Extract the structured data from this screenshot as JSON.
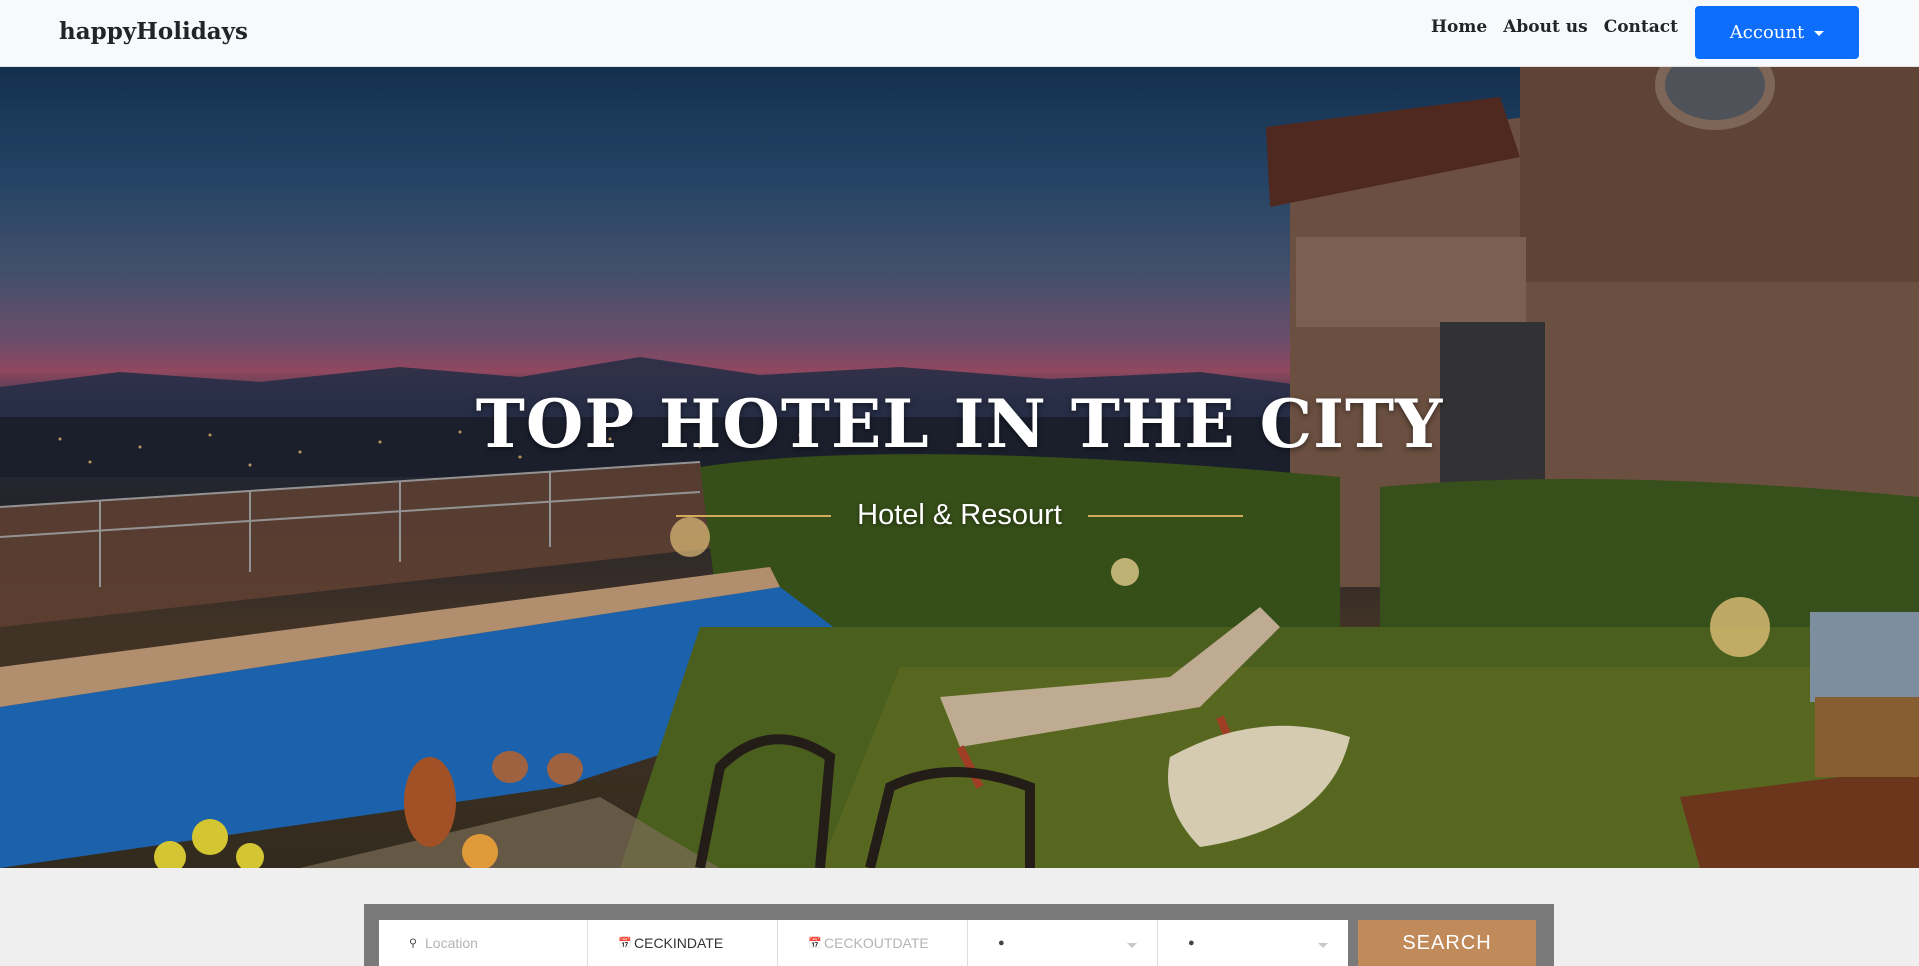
{
  "navbar": {
    "brand": "happyHolidays",
    "links": [
      "Home",
      "About us",
      "Contact"
    ],
    "account_label": "Account"
  },
  "hero": {
    "title": "TOP HOTEL IN THE CITY",
    "subtitle": "Hotel & Resourt"
  },
  "search": {
    "location_placeholder": "Location",
    "checkin_value": "CECKINDATE",
    "checkout_placeholder": "CECKOUTDATE",
    "adults_value": "",
    "children_value": "",
    "button_label": "SEARCH"
  },
  "colors": {
    "account_button": "#0d6efd",
    "search_button": "#c08a5a",
    "hero_line": "#d3a95a"
  }
}
